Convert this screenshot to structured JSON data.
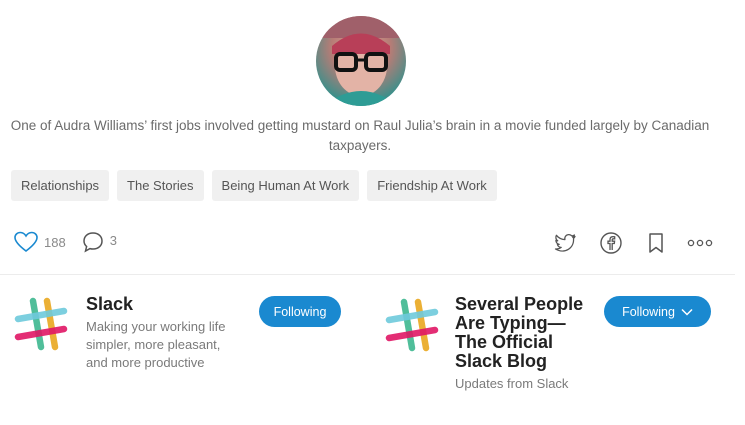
{
  "author": {
    "avatar_alt": "author-avatar",
    "bio": "One of Audra Williams’ first jobs involved getting mustard on Raul Julia’s brain in a movie funded largely by Canadian taxpayers."
  },
  "tags": [
    "Relationships",
    "The Stories",
    "Being Human At Work",
    "Friendship At Work"
  ],
  "actions": {
    "claps": "188",
    "responses": "3"
  },
  "publications": [
    {
      "name": "Slack",
      "description": "Making your working life simpler, more pleasant, and more productive",
      "button_label": "Following"
    },
    {
      "name": "Several People Are Typing— The Official Slack Blog",
      "description": "Updates from Slack",
      "button_label": "Following"
    }
  ],
  "colors": {
    "accent": "#1a89d0",
    "tag_bg": "#f0f0f0"
  }
}
